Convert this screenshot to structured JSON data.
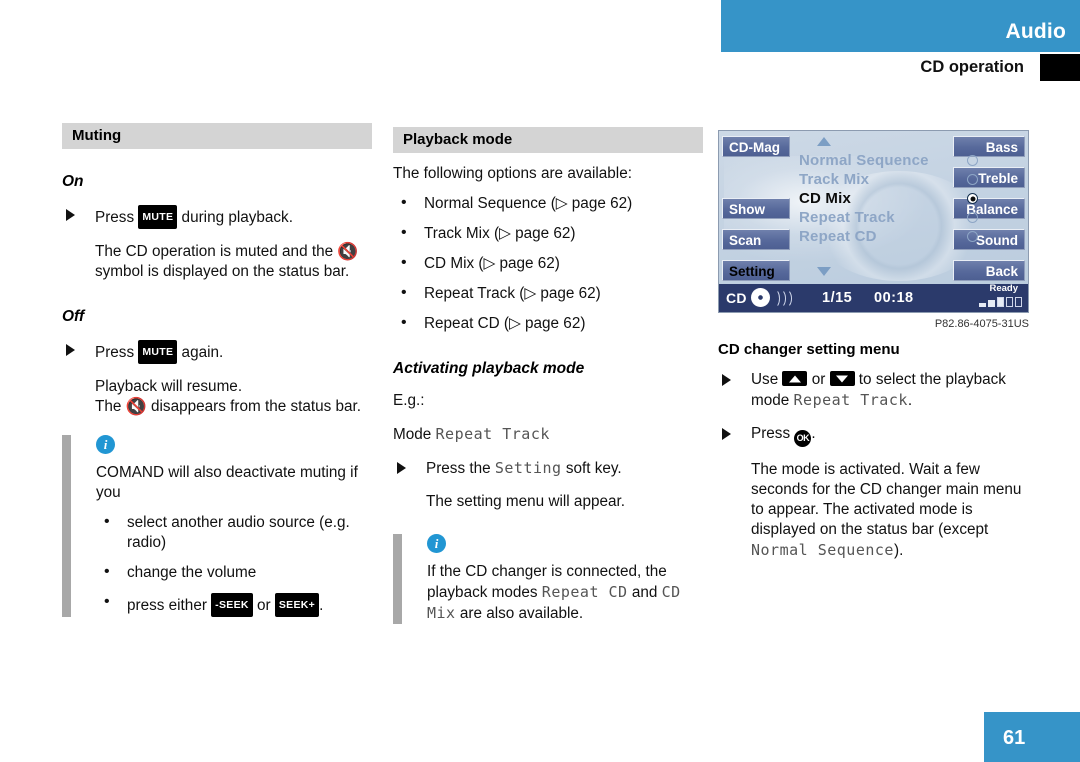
{
  "header": {
    "section": "Audio",
    "subsection": "CD operation"
  },
  "footer": {
    "page_number": "61"
  },
  "accent_color": "#3694c8",
  "col1": {
    "section_title": "Muting",
    "on_label": "On",
    "on_step": "Press ",
    "on_step_key": "MUTE",
    "on_step_tail": " during playback.",
    "on_result_a": "The CD operation is muted and the ",
    "on_result_b": " symbol is displayed on the status bar.",
    "off_label": "Off",
    "off_step": "Press ",
    "off_step_key": "MUTE",
    "off_step_tail": " again.",
    "off_result_1": "Playback will resume.",
    "off_result_2a": "The ",
    "off_result_2b": " disappears from the status bar.",
    "note_intro": "COMAND will also deactivate muting if you",
    "note_bullets": [
      "select another audio source (e.g. radio)",
      "change the volume"
    ],
    "note_bullet_seek_pre": "press either ",
    "note_bullet_seek_key1": "-SEEK",
    "note_bullet_seek_mid": " or ",
    "note_bullet_seek_key2": "SEEK+",
    "note_bullet_seek_post": "."
  },
  "col2": {
    "section_title": "Playback mode",
    "intro": "The following options are available:",
    "options": [
      "Normal Sequence (▷ page 62)",
      "Track Mix (▷ page 62)",
      "CD Mix (▷ page 62)",
      "Repeat Track (▷ page 62)",
      "Repeat CD (▷ page 62)"
    ],
    "subhead": "Activating playback mode",
    "eg": "E.g.:",
    "mode_label": "Mode ",
    "mode_value": "Repeat Track",
    "step_pre": "Press the ",
    "step_key": "Setting",
    "step_post": " soft key.",
    "step_result": "The setting menu will appear.",
    "note_a": "If the CD changer is connected, the playback modes ",
    "note_key1": "Repeat CD",
    "note_b": " and ",
    "note_key2": "CD Mix",
    "note_c": " are also available."
  },
  "col3": {
    "screen": {
      "softkeys_left": [
        "CD-Mag",
        "Show",
        "Scan",
        "Setting"
      ],
      "softkeys_left_selected": "Setting",
      "softkeys_right": [
        "Bass",
        "Treble",
        "Balance",
        "Sound",
        "Back"
      ],
      "list": [
        {
          "label": "Normal Sequence",
          "selected": false
        },
        {
          "label": "Track Mix",
          "selected": false
        },
        {
          "label": "CD Mix",
          "selected": true
        },
        {
          "label": "Repeat Track",
          "selected": false
        },
        {
          "label": "Repeat CD",
          "selected": false
        }
      ],
      "scroll_up_icon": "triangle-up-icon",
      "scroll_down_icon": "triangle-down-icon",
      "status": {
        "source": "CD",
        "track": "1/15",
        "time": "00:18",
        "ready": "Ready"
      }
    },
    "image_code": "P82.86-4075-31US",
    "caption": "CD changer setting menu",
    "step1_pre": "Use ",
    "step1_mid": " or ",
    "step1_post": " to select the playback mode ",
    "step1_mode": "Repeat Track",
    "step1_end": ".",
    "step2_pre": "Press ",
    "step2_key": "OK",
    "step2_post": ".",
    "result_a": "The mode is activated. Wait a few seconds for the CD changer main menu to appear. The activated mode is displayed on the status bar (except ",
    "result_mode": "Normal Sequence",
    "result_b": ")."
  }
}
